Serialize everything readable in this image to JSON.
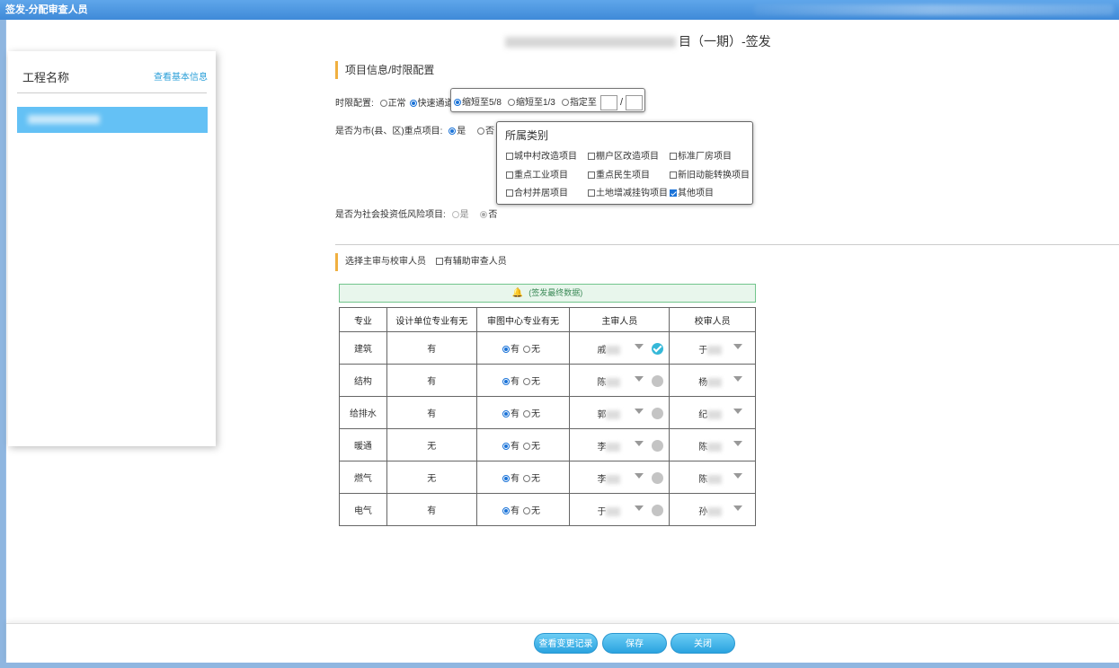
{
  "window": {
    "title": "签发-分配审查人员"
  },
  "page": {
    "title_suffix": "目（一期）-签发"
  },
  "left_panel": {
    "title": "工程名称",
    "link": "查看基本信息"
  },
  "section1": {
    "title": "项目信息/时限配置"
  },
  "time_config": {
    "label": "时限配置:",
    "options": [
      "正常",
      "快速通道"
    ],
    "shorten_options": [
      "缩短至5/8",
      "缩短至1/3",
      "指定至"
    ],
    "slash": "/"
  },
  "key_project": {
    "label": "是否为市(县、区)重点项目:",
    "yes": "是",
    "no": "否"
  },
  "category": {
    "title": "所属类别",
    "items": [
      "城中村改造项目",
      "棚户区改造项目",
      "标准厂房项目",
      "重点工业项目",
      "重点民生项目",
      "新旧动能转换项目",
      "合村并居项目",
      "土地增减挂钩项目",
      "其他项目"
    ]
  },
  "low_risk": {
    "label": "是否为社会投资低风险项目:",
    "yes": "是",
    "no": "否"
  },
  "section2": {
    "title": "选择主审与校审人员",
    "assist_label": "有辅助审查人员"
  },
  "notice": {
    "text": "(签发最终数据)"
  },
  "table": {
    "headers": [
      "专业",
      "设计单位专业有无",
      "审图中心专业有无",
      "主审人员",
      "校审人员"
    ],
    "yes": "有",
    "no": "无",
    "rows": [
      {
        "major": "建筑",
        "design": "有",
        "main": "戚",
        "review": "于"
      },
      {
        "major": "结构",
        "design": "有",
        "main": "陈",
        "review": "杨"
      },
      {
        "major": "给排水",
        "design": "有",
        "main": "郭",
        "review": "纪"
      },
      {
        "major": "暖通",
        "design": "无",
        "main": "李",
        "review": "陈"
      },
      {
        "major": "燃气",
        "design": "无",
        "main": "李",
        "review": "陈"
      },
      {
        "major": "电气",
        "design": "有",
        "main": "于",
        "review": "孙"
      }
    ]
  },
  "footer": {
    "history": "查看变更记录",
    "save": "保存",
    "close": "关闭"
  }
}
